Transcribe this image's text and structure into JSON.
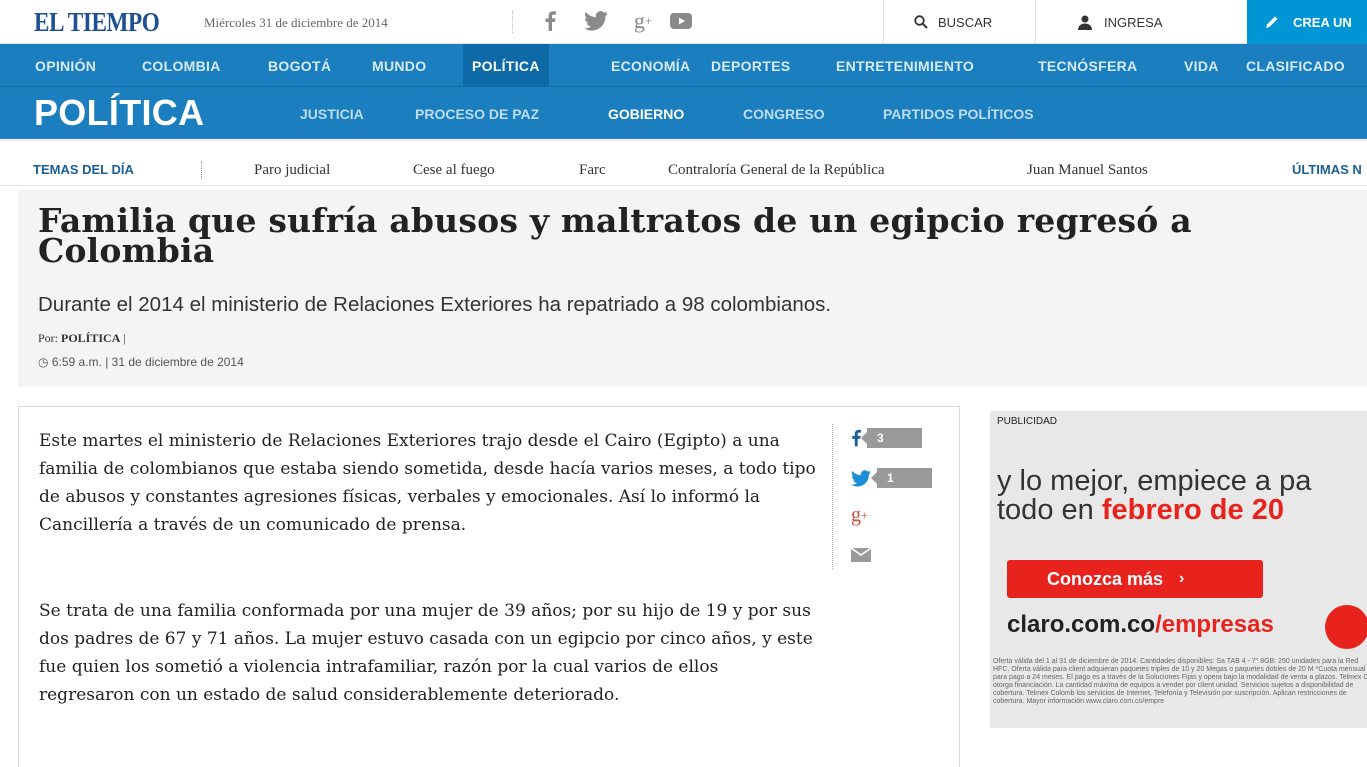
{
  "topbar": {
    "logo": "EL TIEMPO",
    "date": "Miércoles 31 de diciembre de 2014",
    "social_icons": [
      "facebook-icon",
      "twitter-icon",
      "google-plus-icon",
      "youtube-icon"
    ],
    "search_label": "BUSCAR",
    "login_label": "INGRESA",
    "create_label": "CREA UN"
  },
  "main_nav": [
    "OPINIÓN",
    "COLOMBIA",
    "BOGOTÁ",
    "MUNDO",
    "POLÍTICA",
    "ECONOMÍA",
    "DEPORTES",
    "ENTRETENIMIENTO",
    "TECNÓSFERA",
    "VIDA",
    "CLASIFICADO"
  ],
  "main_nav_active": "POLÍTICA",
  "section": {
    "title": "POLÍTICA",
    "sub_nav": [
      "JUSTICIA",
      "PROCESO DE PAZ",
      "GOBIERNO",
      "CONGRESO",
      "PARTIDOS POLÍTICOS"
    ],
    "active": "GOBIERNO"
  },
  "temas": {
    "label": "TEMAS DEL DÍA",
    "items": [
      "Paro judicial",
      "Cese al fuego",
      "Farc",
      "Contraloría General de la República",
      "Juan Manuel Santos"
    ],
    "ultimas": "ÚLTIMAS N"
  },
  "article": {
    "headline": "Familia que sufría abusos y maltratos de un egipcio regresó a Colombia",
    "subhead": "Durante el 2014 el ministerio de Relaciones Exteriores ha repatriado a 98 colombianos.",
    "byline_prefix": "Por:",
    "byline_author": "POLÍTICA",
    "byline_sep": "|",
    "time": "6:59 a.m.",
    "date_sep": "|",
    "date": "31 de diciembre de 2014",
    "paragraphs": [
      "Este martes el ministerio de Relaciones Exteriores trajo desde el Cairo (Egipto) a una familia de colombianos que estaba siendo sometida, desde hacía varios meses, a todo tipo de abusos y constantes agresiones físicas, verbales y emocionales. Así lo informó la Cancillería a través de un comunicado de prensa.",
      "Se trata de una familia conformada por una mujer de 39 años; por su hijo de 19 y por sus dos padres de 67 y 71 años. La mujer estuvo casada con un egipcio por cinco años, y este fue quien los sometió a violencia intrafamiliar, razón por la cual varios de ellos regresaron con un estado de salud considerablemente deteriorado."
    ]
  },
  "share": {
    "facebook_count": "3",
    "twitter_count": "1"
  },
  "ad": {
    "label": "PUBLICIDAD",
    "line1": "y lo mejor, empiece a pa",
    "line2_prefix": "todo en ",
    "line2_highlight": "febrero de 20",
    "button": "Conozca más",
    "button_arrow": "›",
    "url_prefix": "claro.com.co",
    "url_suffix": "/empresas",
    "fine_print": "Oferta válida del 1 al 31 de diciembre de 2014. Cantidades disponibles: Sa TAB 4 - 7\" 8GB: 250 unidades para la Red HFC. Oferta válida para client adquieran paquetes triples de 10 y 20 Megas o paquetes dobles de 20 M *Cuota mensual para pago a 24 meses. El pago es a través de la Soluciones Fijas y opera bajo la modalidad de venta a plazos. Telmex Co otorga financiación. La cantidad máxima de equipos a vender por client unidad. Servicios sujetos a disponibilidad de cobertura. Telmex Colomb los servicios de Internet, Telefonía y Televisión por suscripción. Aplican restricciones de cobertura. Mayor información www.claro.com.co/empre"
  }
}
